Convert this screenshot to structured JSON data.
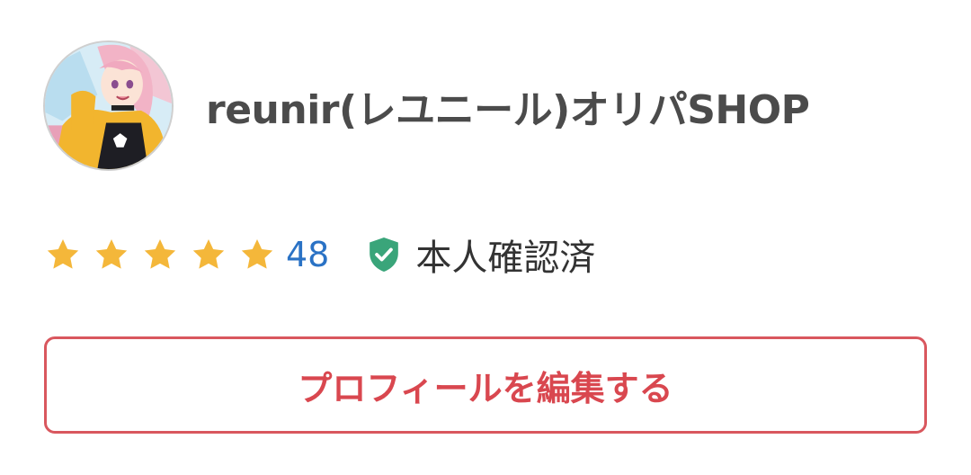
{
  "shop": {
    "name": "reunir(レユニール)オリパSHOP",
    "avatar_icon": "shop-avatar-anime-character"
  },
  "rating": {
    "stars": 5,
    "max_stars": 5,
    "star_color": "#f4b73a",
    "review_count": "48",
    "review_count_color": "#2a72c5"
  },
  "verification": {
    "icon": "shield-check-icon",
    "icon_color": "#3aa57a",
    "label": "本人確認済"
  },
  "edit_profile": {
    "label": "プロフィールを編集する",
    "accent_color": "#d9474f"
  }
}
